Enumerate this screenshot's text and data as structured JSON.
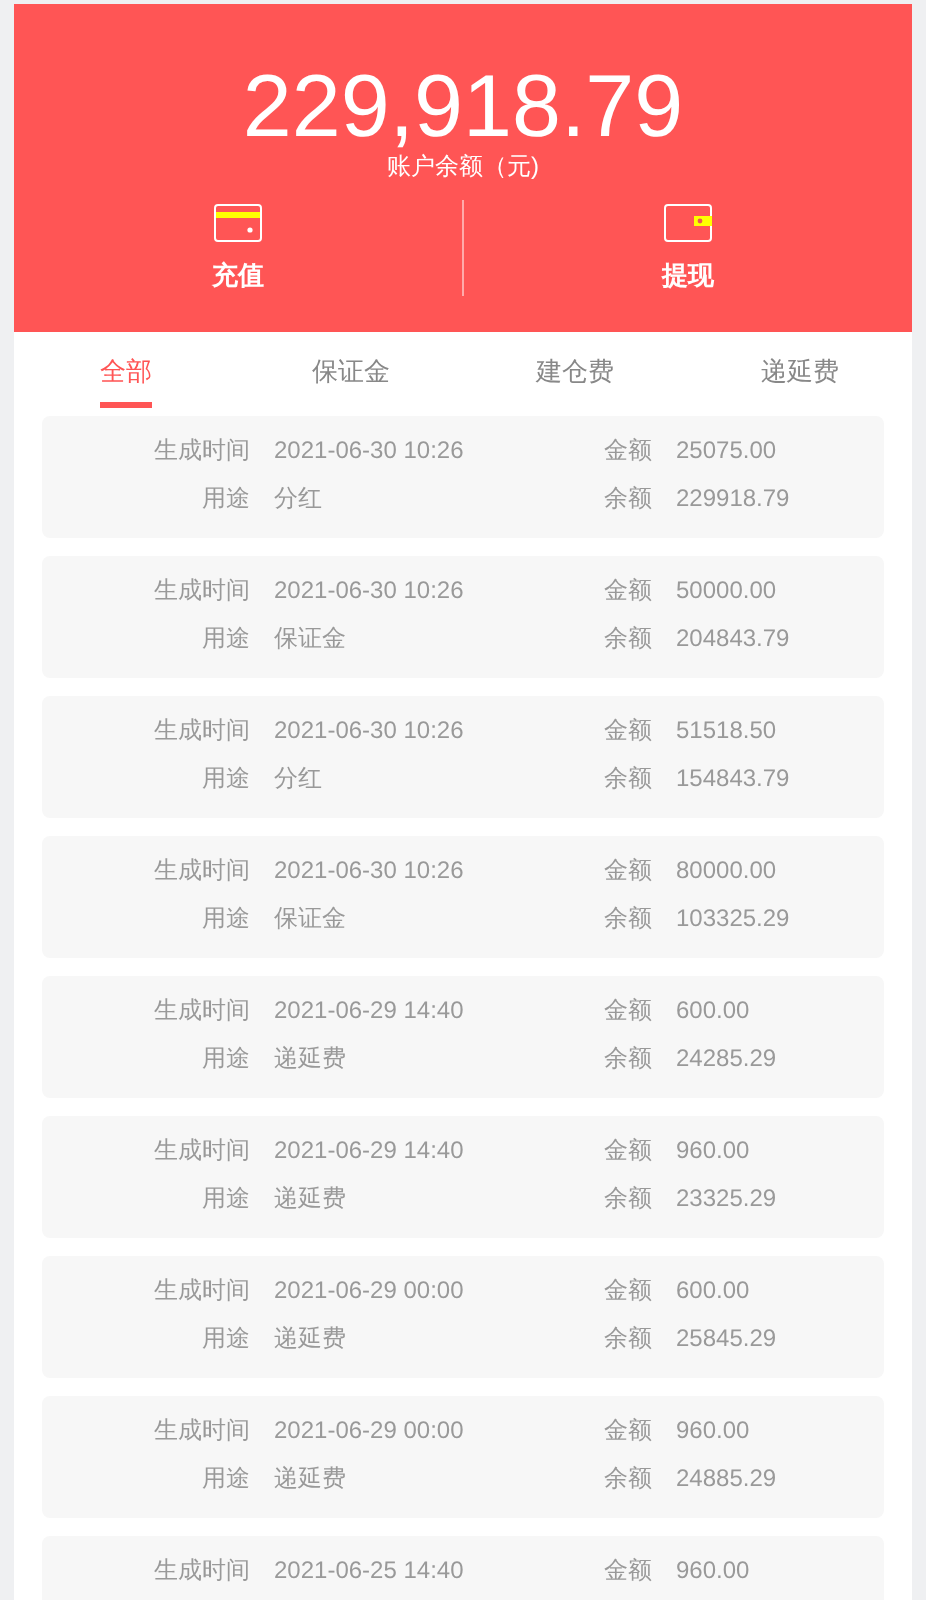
{
  "balance": {
    "amount": "229,918.79",
    "label": "账户余额（元)"
  },
  "actions": [
    {
      "kind": "deposit",
      "label": "充值"
    },
    {
      "kind": "withdraw",
      "label": "提现"
    }
  ],
  "tabs": [
    {
      "label": "全部",
      "selected": true
    },
    {
      "label": "保证金",
      "selected": false
    },
    {
      "label": "建仓费",
      "selected": false
    },
    {
      "label": "递延费",
      "selected": false
    }
  ],
  "records": [
    {
      "time_label": "生成时间",
      "time": "2021-06-30 10:26",
      "amount_label": "金额",
      "amount": "25075.00",
      "purpose_label": "用途",
      "purpose": "分红",
      "balance_label": "余额",
      "balance": "229918.79"
    },
    {
      "time_label": "生成时间",
      "time": "2021-06-30 10:26",
      "amount_label": "金额",
      "amount": "50000.00",
      "purpose_label": "用途",
      "purpose": "保证金",
      "balance_label": "余额",
      "balance": "204843.79"
    },
    {
      "time_label": "生成时间",
      "time": "2021-06-30 10:26",
      "amount_label": "金额",
      "amount": "51518.50",
      "purpose_label": "用途",
      "purpose": "分红",
      "balance_label": "余额",
      "balance": "154843.79"
    },
    {
      "time_label": "生成时间",
      "time": "2021-06-30 10:26",
      "amount_label": "金额",
      "amount": "80000.00",
      "purpose_label": "用途",
      "purpose": "保证金",
      "balance_label": "余额",
      "balance": "103325.29"
    },
    {
      "time_label": "生成时间",
      "time": "2021-06-29 14:40",
      "amount_label": "金额",
      "amount": "600.00",
      "purpose_label": "用途",
      "purpose": "递延费",
      "balance_label": "余额",
      "balance": "24285.29"
    },
    {
      "time_label": "生成时间",
      "time": "2021-06-29 14:40",
      "amount_label": "金额",
      "amount": "960.00",
      "purpose_label": "用途",
      "purpose": "递延费",
      "balance_label": "余额",
      "balance": "23325.29"
    },
    {
      "time_label": "生成时间",
      "time": "2021-06-29 00:00",
      "amount_label": "金额",
      "amount": "600.00",
      "purpose_label": "用途",
      "purpose": "递延费",
      "balance_label": "余额",
      "balance": "25845.29"
    },
    {
      "time_label": "生成时间",
      "time": "2021-06-29 00:00",
      "amount_label": "金额",
      "amount": "960.00",
      "purpose_label": "用途",
      "purpose": "递延费",
      "balance_label": "余额",
      "balance": "24885.29"
    },
    {
      "time_label": "生成时间",
      "time": "2021-06-25 14:40",
      "amount_label": "金额",
      "amount": "960.00"
    }
  ]
}
